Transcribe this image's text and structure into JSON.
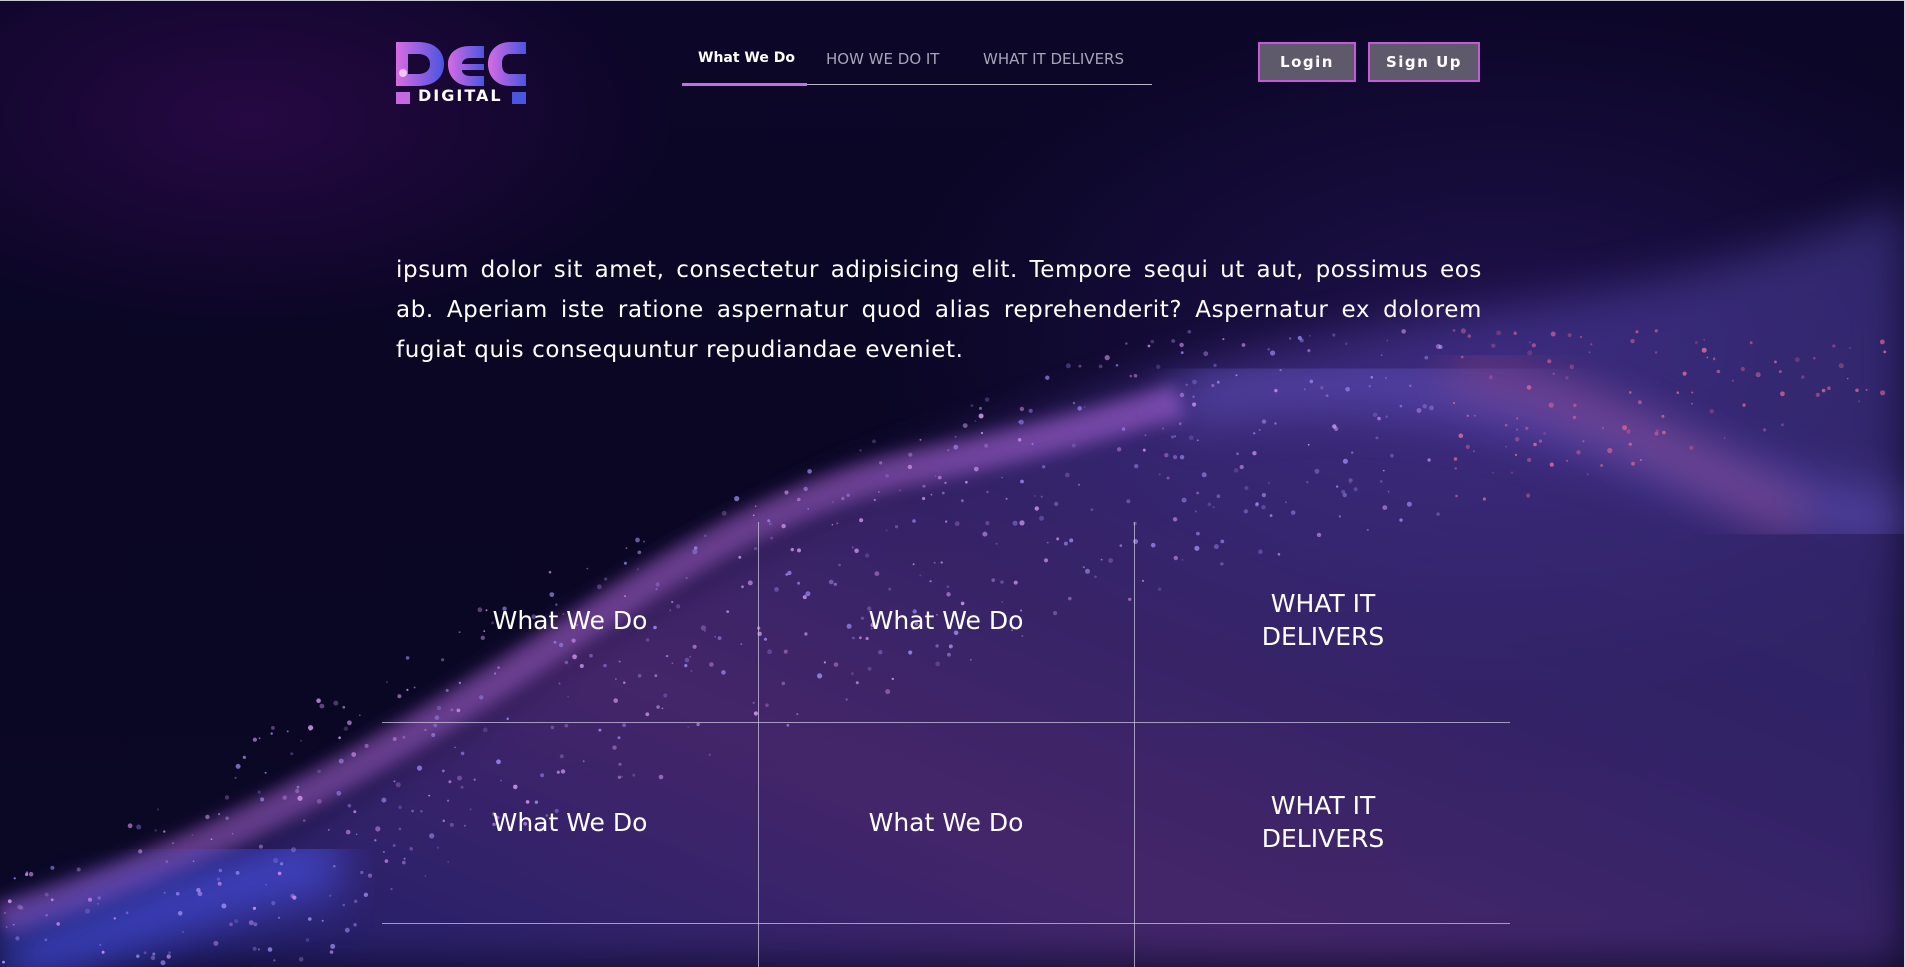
{
  "brand": {
    "logo_word": "DIGITAL",
    "colors": {
      "gradient_start": "#d86be3",
      "gradient_end": "#4a55e0",
      "accent": "#c45ad9"
    }
  },
  "nav": {
    "items": [
      {
        "label": "What We Do",
        "active": true
      },
      {
        "label": "HOW WE DO IT",
        "active": false
      },
      {
        "label": "WHAT IT DELIVERS",
        "active": false
      }
    ]
  },
  "auth": {
    "login_label": "Login",
    "signup_label": "Sign Up"
  },
  "intro": {
    "text": "ipsum dolor sit amet, consectetur adipisicing elit. Tempore sequi ut aut, possimus eos ab. Aperiam iste ratione aspernatur quod alias reprehenderit? Aspernatur ex dolorem fugiat quis consequuntur repudiandae eveniet."
  },
  "grid": {
    "cells": [
      {
        "label": "What We Do"
      },
      {
        "label": "What We Do"
      },
      {
        "label": "WHAT IT DELIVERS"
      },
      {
        "label": "What We Do"
      },
      {
        "label": "What We Do"
      },
      {
        "label": "WHAT IT DELIVERS"
      }
    ]
  }
}
